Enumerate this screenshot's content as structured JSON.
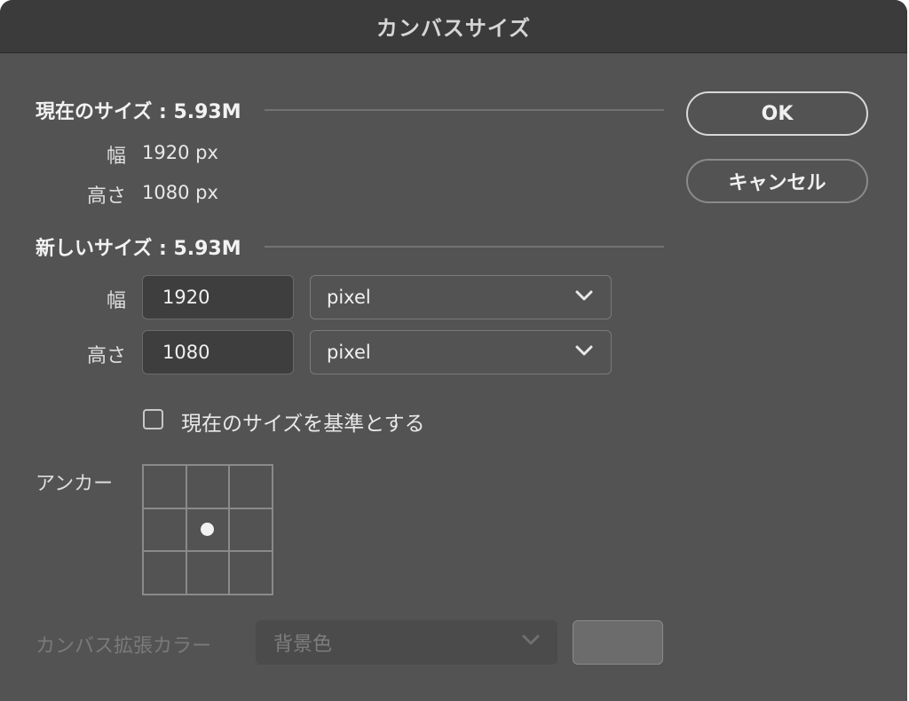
{
  "window": {
    "title": "カンバスサイズ"
  },
  "current_size": {
    "heading": "現在のサイズ : 5.93M",
    "width_label": "幅",
    "width_value": "1920 px",
    "height_label": "高さ",
    "height_value": "1080 px"
  },
  "new_size": {
    "heading": "新しいサイズ : 5.93M",
    "width_label": "幅",
    "width_value": "1920",
    "width_unit": "pixel",
    "height_label": "高さ",
    "height_value": "1080",
    "height_unit": "pixel"
  },
  "relative": {
    "label": "現在のサイズを基準とする",
    "checked": false
  },
  "anchor": {
    "label": "アンカー",
    "selected": "center"
  },
  "extension_color": {
    "label": "カンバス拡張カラー",
    "value": "背景色",
    "swatch_color": "#6c6c6c"
  },
  "buttons": {
    "ok": "OK",
    "cancel": "キャンセル"
  },
  "icons": {
    "dropdown": "chevron-down-icon"
  }
}
